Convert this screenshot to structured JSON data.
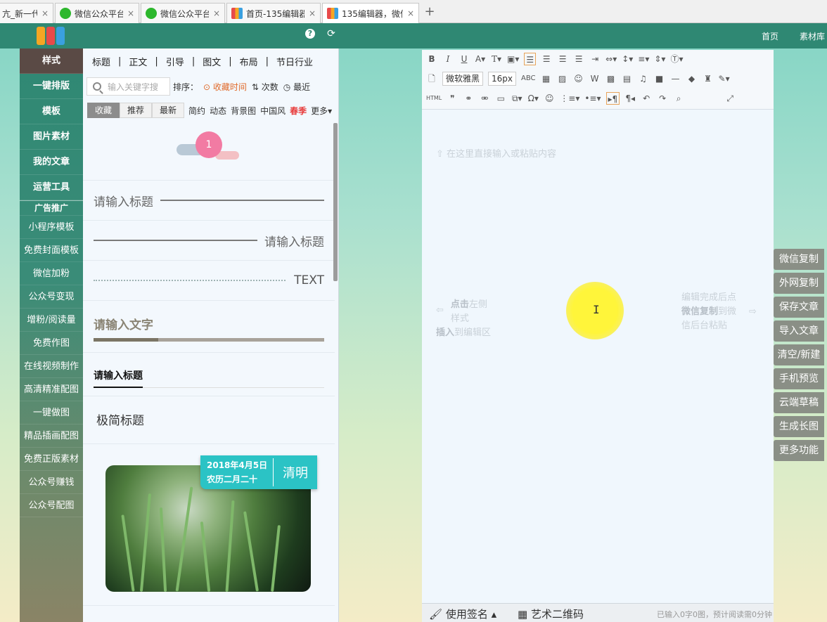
{
  "browser": {
    "tabs": [
      {
        "label": "亢_新一代",
        "icon": "none"
      },
      {
        "label": "微信公众平台",
        "icon": "wechat"
      },
      {
        "label": "微信公众平台",
        "icon": "wechat"
      },
      {
        "label": "首页-135编辑器",
        "icon": "135"
      },
      {
        "label": "135编辑器，微信",
        "icon": "135",
        "active": true
      }
    ],
    "close_glyph": "×",
    "new_tab_glyph": "+"
  },
  "header": {
    "help_glyph": "?",
    "refresh_glyph": "⟳",
    "nav": [
      "首页",
      "素材库"
    ]
  },
  "leftnav": {
    "main": [
      "样式",
      "一键排版",
      "模板",
      "图片素材",
      "我的文章",
      "运营工具"
    ],
    "ad_heading": "广告推广",
    "sub": [
      "小程序模板",
      "免费封面模板",
      "微信加粉",
      "公众号变现",
      "增粉/阅读量",
      "免费作图",
      "在线视频制作",
      "高清精准配图",
      "一键做图",
      "精品插画配图",
      "免费正版素材",
      "公众号赚钱",
      "公众号配图"
    ]
  },
  "stylepanel": {
    "categories": [
      "标题",
      "正文",
      "引导",
      "图文",
      "布局",
      "节日行业"
    ],
    "cat_separator": "|",
    "search_placeholder": "输入关键字搜",
    "sort_label": "排序：",
    "sort_options": [
      "收藏时间",
      "次数",
      "最近"
    ],
    "filter_buttons": [
      "收藏",
      "推荐",
      "最新"
    ],
    "filter_tags": [
      "简约",
      "动态",
      "背景图",
      "中国风",
      "春季",
      "更多▾"
    ],
    "items": {
      "badge_number": "1",
      "title_left": "请输入标题",
      "title_right": "请输入标题",
      "text_label": "TEXT",
      "progress_title": "请输入文字",
      "progress_value": 0.28,
      "underline_title": "请输入标题",
      "simple_title": "极简标题",
      "photo_date": "2018年4月5日",
      "photo_lunar": "农历二月二十",
      "photo_festival": "清明"
    }
  },
  "editor": {
    "font_name": "微软雅黑",
    "font_size": "16px",
    "placeholder": "在这里直接输入或粘贴内容",
    "hint_left_bold1": "点击",
    "hint_left_1": "左侧样式",
    "hint_left_bold2": "插入",
    "hint_left_2": "到编辑区",
    "hint_right_1": "编辑完成后点",
    "hint_right_bold": "微信复制",
    "hint_right_2": "到微",
    "hint_right_3": "信后台粘贴",
    "cursor_glyph": "I",
    "status": {
      "signature": "使用签名",
      "qrcode": "艺术二维码",
      "count": "已输入0字0图，预计阅读需0分钟"
    }
  },
  "actions": [
    "微信复制",
    "外网复制",
    "保存文章",
    "导入文章",
    "清空/新建",
    "手机预览",
    "云端草稿",
    "生成长图",
    "更多功能"
  ],
  "colors": {
    "brand_green": "#2f8873",
    "active_nav": "#5a4a45",
    "festival_card": "#2bc3c5",
    "badge_pink": "#f27ba3",
    "sort_active": "#e06a2b",
    "hot_tag": "#e83c3c"
  }
}
